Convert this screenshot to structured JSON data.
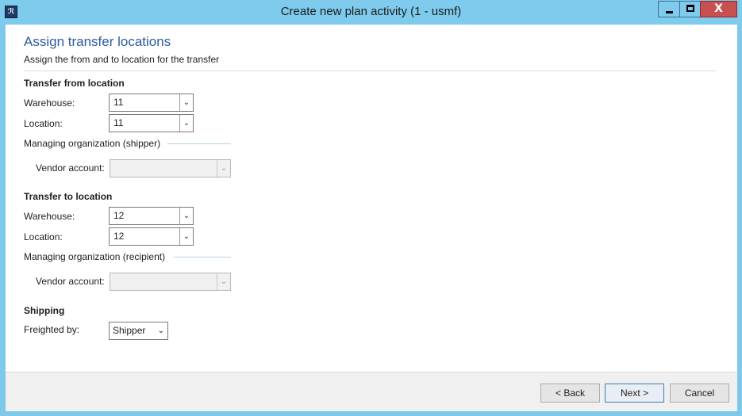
{
  "window": {
    "title": "Create new plan activity (1 - usmf)",
    "icon": "app-icon",
    "icon_glyph": "ℛ",
    "minimize_icon": "minimize-icon",
    "maximize_icon": "maximize-icon",
    "close_glyph": "X"
  },
  "header": {
    "title": "Assign transfer locations",
    "subtitle": "Assign the from and to location for the transfer"
  },
  "from": {
    "section_title": "Transfer from location",
    "warehouse_label": "Warehouse:",
    "warehouse_value": "11",
    "location_label": "Location:",
    "location_value": "11",
    "group_title": "Managing organization (shipper)",
    "vendor_label": "Vendor account:",
    "vendor_value": ""
  },
  "to": {
    "section_title": "Transfer to location",
    "warehouse_label": "Warehouse:",
    "warehouse_value": "12",
    "location_label": "Location:",
    "location_value": "12",
    "group_title": "Managing organization (recipient)",
    "vendor_label": "Vendor account:",
    "vendor_value": ""
  },
  "shipping": {
    "section_title": "Shipping",
    "freighted_by_label": "Freighted by:",
    "freighted_by_value": "Shipper"
  },
  "footer": {
    "back_label": "< Back",
    "next_label": "Next >",
    "cancel_label": "Cancel"
  },
  "colors": {
    "titlebar": "#7ecbed",
    "heading": "#2e5a9c",
    "close_button": "#c75050"
  }
}
